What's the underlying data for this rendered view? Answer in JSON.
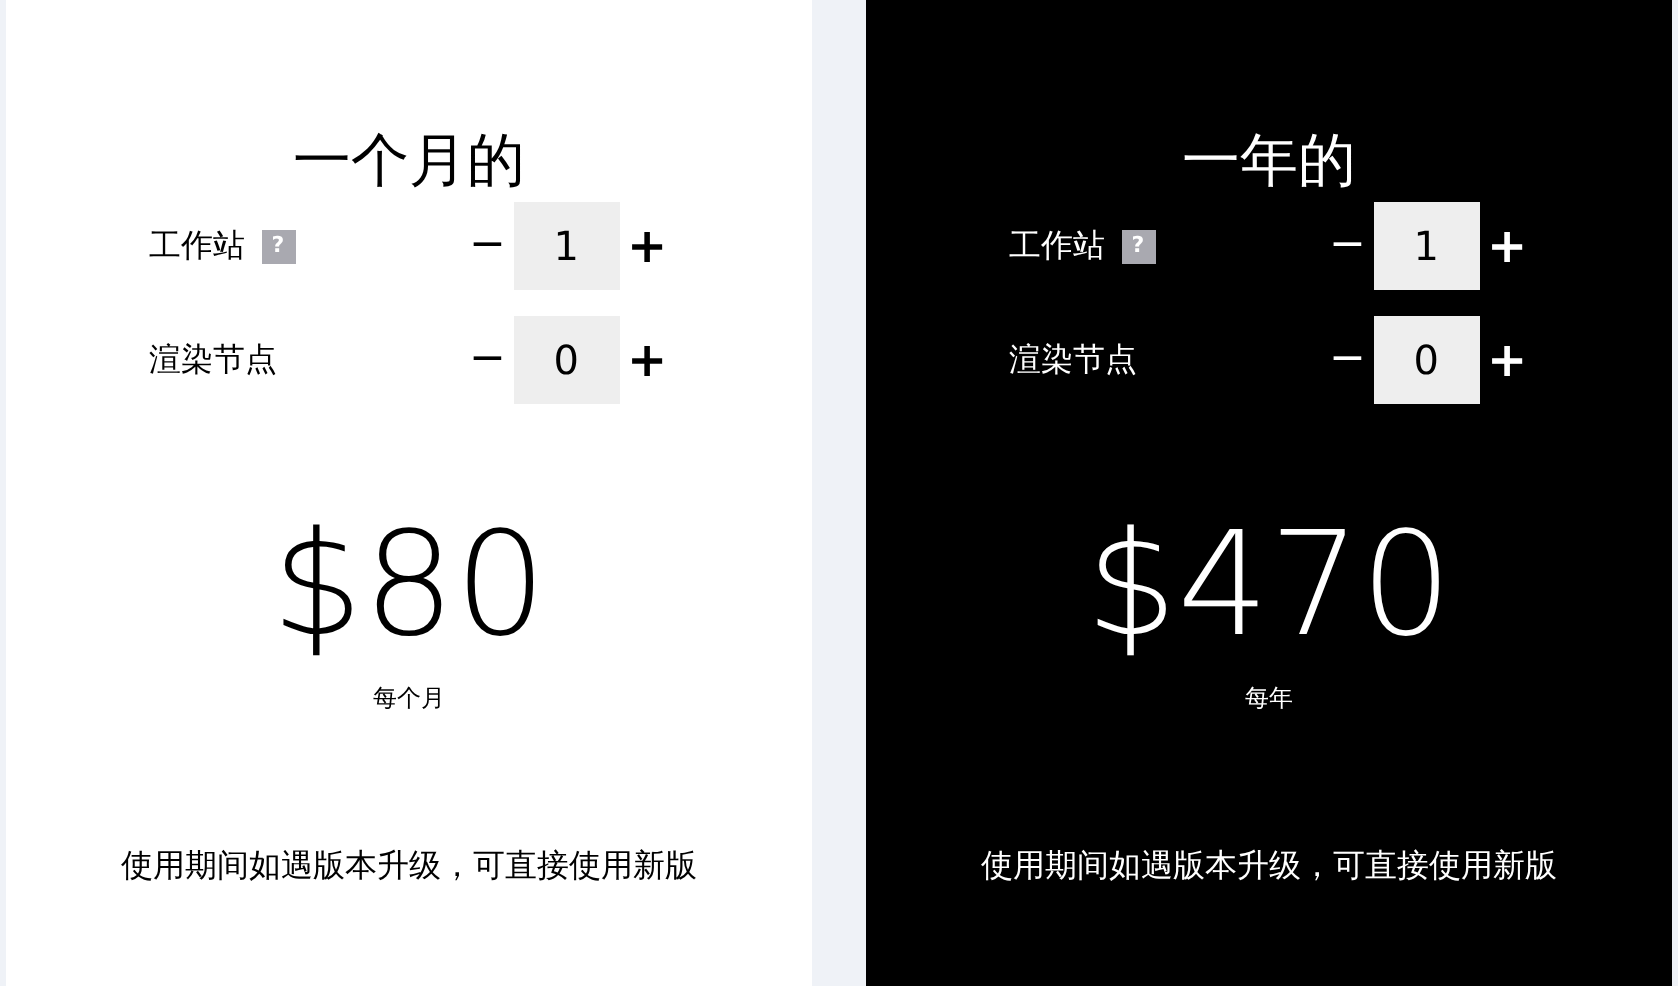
{
  "plans": [
    {
      "kind": "light",
      "title": "一个月的",
      "rows": [
        {
          "label": "工作站",
          "help": "?",
          "minus": "−",
          "value": "1",
          "plus": "+"
        },
        {
          "label": "渲染节点",
          "minus": "−",
          "value": "0",
          "plus": "+"
        }
      ],
      "price": "$80",
      "period": "每个月",
      "note": "使用期间如遇版本升级，可直接使用新版"
    },
    {
      "kind": "dark",
      "title": "一年的",
      "rows": [
        {
          "label": "工作站",
          "help": "?",
          "minus": "−",
          "value": "1",
          "plus": "+"
        },
        {
          "label": "渲染节点",
          "minus": "−",
          "value": "0",
          "plus": "+"
        }
      ],
      "price": "$470",
      "period": "每年",
      "note": "使用期间如遇版本升级，可直接使用新版"
    }
  ]
}
